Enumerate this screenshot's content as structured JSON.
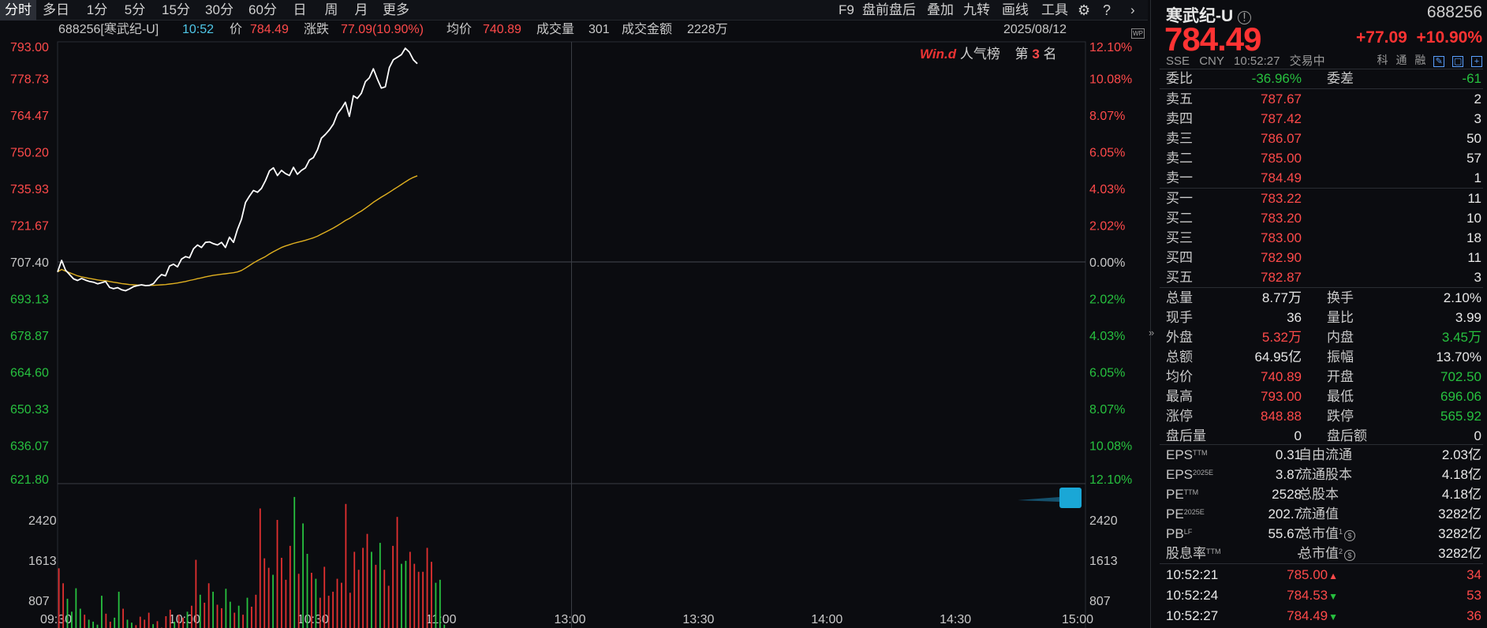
{
  "toolbar": {
    "tabs": [
      "分时",
      "多日",
      "1分",
      "5分",
      "15分",
      "30分",
      "60分",
      "日",
      "周",
      "月",
      "更多"
    ],
    "right_items": [
      "F9",
      "盘前盘后",
      "叠加",
      "九转",
      "画线",
      "工具"
    ]
  },
  "info_bar": {
    "code_name": "688256[寒武纪-U]",
    "time": "10:52",
    "price_label": "价",
    "price": "784.49",
    "change_label": "涨跌",
    "change": "77.09(10.90%)",
    "avg_label": "均价",
    "avg": "740.89",
    "volume_label": "成交量",
    "volume": "301",
    "amount_label": "成交金额",
    "amount": "2228万",
    "date": "2025/08/12"
  },
  "popularity": {
    "brand": "Win.d",
    "label": "人气榜",
    "rank_prefix": "第",
    "rank": "3",
    "rank_suffix": "名"
  },
  "chart_data": {
    "type": "line",
    "prev_close": 707.4,
    "price_ylim": [
      621.8,
      793.0
    ],
    "price_ticks": [
      "793.00",
      "778.73",
      "764.47",
      "750.20",
      "735.93",
      "721.67",
      "707.40",
      "693.13",
      "678.87",
      "664.60",
      "650.33",
      "636.07",
      "621.80"
    ],
    "pct_ticks": [
      "12.10%",
      "10.08%",
      "8.07%",
      "6.05%",
      "4.03%",
      "2.02%",
      "0.00%",
      "2.02%",
      "4.03%",
      "6.05%",
      "8.07%",
      "10.08%",
      "12.10%"
    ],
    "x_ticks": [
      "09:30",
      "10:00",
      "10:30",
      "11:00",
      "13:00",
      "13:30",
      "14:00",
      "14:30",
      "15:00"
    ],
    "vol_ticks": [
      "2420",
      "1613",
      "807"
    ],
    "vol_ylim": [
      0,
      3100
    ],
    "session_minutes": 240,
    "series": [
      {
        "values": [
          703.5,
          708.0,
          704.2,
          702.5,
          700.8,
          700.2,
          701.0,
          700.3,
          699.8,
          699.5,
          698.9,
          699.3,
          699.8,
          697.5,
          697.0,
          697.4,
          696.6,
          696.2,
          696.9,
          697.8,
          698.2,
          698.5,
          698.2,
          698.3,
          699.0,
          701.0,
          702.5,
          702.0,
          705.8,
          706.5,
          705.5,
          708.5,
          709.5,
          709.0,
          712.5,
          714.0,
          713.0,
          715.0,
          715.2,
          714.5,
          714.0,
          715.0,
          713.0,
          717.0,
          715.0,
          720.0,
          724.0,
          730.5,
          733.0,
          735.2,
          734.5,
          736.0,
          739.0,
          742.8,
          744.0,
          741.0,
          743.0,
          741.8,
          741.0,
          744.2,
          741.5,
          743.0,
          744.0,
          747.0,
          748.0,
          751.0,
          755.5,
          757.0,
          758.8,
          761.0,
          765.0,
          767.0,
          769.5,
          764.0,
          772.0,
          771.0,
          773.0,
          777.5,
          779.0,
          782.5,
          778.5,
          775.0,
          775.5,
          783.0,
          786.0,
          787.0,
          788.0,
          790.5,
          789.0,
          786.0,
          784.49
        ]
      },
      {
        "values": [
          703.5,
          704.5,
          703.8,
          703.2,
          702.6,
          702.0,
          701.6,
          701.3,
          701.0,
          700.7,
          700.4,
          700.2,
          700.1,
          699.8,
          699.5,
          699.3,
          699.0,
          698.8,
          698.6,
          698.5,
          698.4,
          698.4,
          698.3,
          698.3,
          698.3,
          698.4,
          698.5,
          698.6,
          698.8,
          699.0,
          699.2,
          699.5,
          699.8,
          700.2,
          700.5,
          700.9,
          701.2,
          701.6,
          701.9,
          702.2,
          702.4,
          702.6,
          702.8,
          703.0,
          703.2,
          703.5,
          704.1,
          705.0,
          706.0,
          707.0,
          707.9,
          708.7,
          709.5,
          710.5,
          711.4,
          712.2,
          713.0,
          713.6,
          714.1,
          714.6,
          715.0,
          715.4,
          715.8,
          716.3,
          716.8,
          717.4,
          718.2,
          719.0,
          719.8,
          720.6,
          721.5,
          722.5,
          723.5,
          724.3,
          725.3,
          726.3,
          727.2,
          728.3,
          729.4,
          730.6,
          731.6,
          732.6,
          733.5,
          734.5,
          735.5,
          736.5,
          737.5,
          738.5,
          739.5,
          740.3,
          740.89
        ]
      }
    ],
    "volume": [
      1450,
      1150,
      840,
      580,
      1050,
      640,
      520,
      420,
      380,
      320,
      900,
      540,
      380,
      460,
      980,
      640,
      420,
      360,
      310,
      480,
      420,
      560,
      330,
      390,
      260,
      490,
      620,
      380,
      520,
      460,
      580,
      700,
      1620,
      920,
      760,
      1150,
      980,
      720,
      650,
      1040,
      780,
      560,
      700,
      520,
      860,
      680,
      920,
      2650,
      1650,
      1460,
      1320,
      2420,
      1660,
      1220,
      1900,
      2880,
      1340,
      2350,
      1740,
      1360,
      1240,
      860,
      1480,
      900,
      980,
      1240,
      1160,
      2740,
      960,
      1780,
      1420,
      1860,
      2140,
      1780,
      1520,
      1960,
      1420,
      1100,
      1900,
      2480,
      1540,
      1600,
      1780,
      1540,
      1380,
      1380,
      1860,
      1580,
      1160,
      1220,
      320
    ]
  },
  "quote": {
    "name": "寒武纪-U",
    "code": "688256",
    "price": "784.49",
    "change": "+77.09",
    "change_pct": "+10.90%",
    "exchange": "SSE",
    "currency": "CNY",
    "time": "10:52:27",
    "status": "交易中",
    "tags": [
      "科",
      "通",
      "融"
    ],
    "weibi_label": "委比",
    "weibi": "-36.96%",
    "weicha_label": "委差",
    "weicha": "-61",
    "asks": [
      {
        "label": "卖五",
        "price": "787.67",
        "qty": "2"
      },
      {
        "label": "卖四",
        "price": "787.42",
        "qty": "3"
      },
      {
        "label": "卖三",
        "price": "786.07",
        "qty": "50"
      },
      {
        "label": "卖二",
        "price": "785.00",
        "qty": "57"
      },
      {
        "label": "卖一",
        "price": "784.49",
        "qty": "1"
      }
    ],
    "bids": [
      {
        "label": "买一",
        "price": "783.22",
        "qty": "11"
      },
      {
        "label": "买二",
        "price": "783.20",
        "qty": "10"
      },
      {
        "label": "买三",
        "price": "783.00",
        "qty": "18"
      },
      {
        "label": "买四",
        "price": "782.90",
        "qty": "11"
      },
      {
        "label": "买五",
        "price": "782.87",
        "qty": "3"
      }
    ],
    "stats": [
      {
        "k1": "总量",
        "v1": "8.77万",
        "c1": "white",
        "k2": "换手",
        "v2": "2.10%",
        "c2": "white"
      },
      {
        "k1": "现手",
        "v1": "36",
        "c1": "white",
        "k2": "量比",
        "v2": "3.99",
        "c2": "white"
      },
      {
        "k1": "外盘",
        "v1": "5.32万",
        "c1": "red",
        "k2": "内盘",
        "v2": "3.45万",
        "c2": "green"
      },
      {
        "k1": "总额",
        "v1": "64.95亿",
        "c1": "white",
        "k2": "振幅",
        "v2": "13.70%",
        "c2": "white"
      },
      {
        "k1": "均价",
        "v1": "740.89",
        "c1": "red",
        "k2": "开盘",
        "v2": "702.50",
        "c2": "green"
      },
      {
        "k1": "最高",
        "v1": "793.00",
        "c1": "red",
        "k2": "最低",
        "v2": "696.06",
        "c2": "green"
      },
      {
        "k1": "涨停",
        "v1": "848.88",
        "c1": "red",
        "k2": "跌停",
        "v2": "565.92",
        "c2": "green"
      },
      {
        "k1": "盘后量",
        "v1": "0",
        "c1": "white",
        "k2": "盘后额",
        "v2": "0",
        "c2": "white"
      }
    ],
    "fundamentals": [
      {
        "k1": "EPS",
        "s1": "TTM",
        "v1": "0.31",
        "k2": "自由流通",
        "s2": "",
        "v2": "2.03亿"
      },
      {
        "k1": "EPS",
        "s1": "2025E",
        "v1": "3.87",
        "k2": "流通股本",
        "s2": "",
        "v2": "4.18亿"
      },
      {
        "k1": "PE",
        "s1": "TTM",
        "v1": "2528",
        "k2": "总股本",
        "s2": "",
        "v2": "4.18亿"
      },
      {
        "k1": "PE",
        "s1": "2025E",
        "v1": "202.7",
        "k2": "流通值",
        "s2": "",
        "v2": "3282亿"
      },
      {
        "k1": "PB",
        "s1": "LF",
        "v1": "55.67",
        "k2": "总市值",
        "s2": "1",
        "v2": "3282亿"
      },
      {
        "k1": "股息率",
        "s1": "TTM",
        "v1": "-",
        "k2": "总市值",
        "s2": "2",
        "v2": "3282亿"
      }
    ],
    "ticks": [
      {
        "time": "10:52:21",
        "price": "785.00",
        "dir": "up",
        "qty": "34"
      },
      {
        "time": "10:52:24",
        "price": "784.53",
        "dir": "down",
        "qty": "53"
      },
      {
        "time": "10:52:27",
        "price": "784.49",
        "dir": "down",
        "qty": "36"
      }
    ]
  },
  "colors": {
    "up": "#ff4a4a",
    "down": "#27c13f",
    "price_line": "#ffffff",
    "avg_line": "#e0b020",
    "accent_time": "#4fc7e8"
  }
}
